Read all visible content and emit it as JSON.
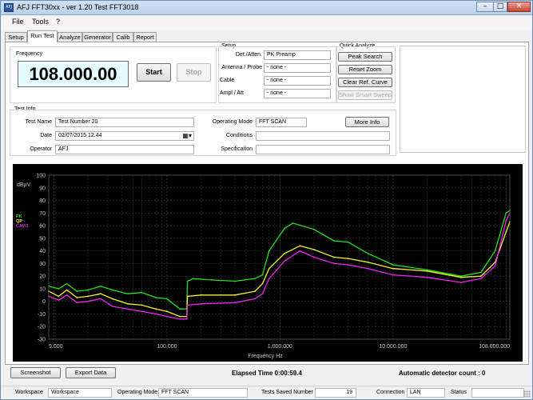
{
  "window": {
    "title": "AFJ FFT30xx - ver 1.20 Test FFT3018",
    "icon": "afj-app-icon",
    "controls": {
      "minimize": "–",
      "maximize": "□",
      "close": "✕"
    }
  },
  "menu": {
    "items": [
      "File",
      "Tools",
      "?"
    ]
  },
  "tabs": [
    "Setup",
    "Run Test",
    "Analyze",
    "Generator",
    "Calib",
    "Report"
  ],
  "active_tab": "Run Test",
  "frequency": {
    "label": "Frequency",
    "value": "108.000.00"
  },
  "controls": {
    "start": "Start",
    "stop": "Stop"
  },
  "setup": {
    "title": "Setup",
    "rows": [
      {
        "label": "Det./Atten.",
        "value": "PK  Preamp"
      },
      {
        "label": "Antenna / Probe",
        "value": "- none -"
      },
      {
        "label": "Cable",
        "value": "- none -"
      },
      {
        "label": "Ampl / Att",
        "value": "- none -"
      }
    ]
  },
  "quick_analyze": {
    "title": "Quick Analyze",
    "buttons": [
      "Peak Search",
      "Reset Zoom",
      "Clear Ref. Curve",
      "Show Smart Sweep"
    ]
  },
  "test_info": {
    "title": "Test Info",
    "test_name_label": "Test Name",
    "test_name": "Test Number 20",
    "date_label": "Date",
    "date": "02/07/2015 12.44",
    "operator_label": "Operator",
    "operator": "AFJ",
    "operating_mode_label": "Operating Mode",
    "operating_mode": "FFT SCAN",
    "conditions_label": "Conditions",
    "conditions": "",
    "specification_label": "Specification",
    "specification": "",
    "more_info": "More Info"
  },
  "chart_data": {
    "type": "line",
    "ylabel": "dBµV",
    "xlabel": "Frequency Hz",
    "x_scale": "log",
    "xlim": [
      9000,
      108000000
    ],
    "ylim": [
      -30,
      100
    ],
    "y_ticks": [
      "100",
      "90",
      "80",
      "70",
      "60",
      "50",
      "40",
      "30",
      "20",
      "10",
      "0",
      "-10",
      "-20",
      "-30"
    ],
    "x_ticks": [
      {
        "value": 9000,
        "label": "9.000"
      },
      {
        "value": 100000,
        "label": "100.000"
      },
      {
        "value": 1000000,
        "label": "1.000.000"
      },
      {
        "value": 10000000,
        "label": "10.000.000"
      },
      {
        "value": 108000000,
        "label": "108.000.000"
      }
    ],
    "grid": true,
    "legend_position": "top-left",
    "series": [
      {
        "name": "PK",
        "color": "#22e11e",
        "points": [
          [
            9000,
            12
          ],
          [
            11000,
            10
          ],
          [
            13000,
            14
          ],
          [
            16000,
            8
          ],
          [
            20000,
            9
          ],
          [
            26000,
            12
          ],
          [
            33000,
            9
          ],
          [
            45000,
            6
          ],
          [
            60000,
            7
          ],
          [
            80000,
            3
          ],
          [
            100000,
            2
          ],
          [
            130000,
            -6
          ],
          [
            150000,
            -6
          ],
          [
            152000,
            16
          ],
          [
            170000,
            18
          ],
          [
            250000,
            17
          ],
          [
            400000,
            16
          ],
          [
            600000,
            18
          ],
          [
            700000,
            21
          ],
          [
            800000,
            40
          ],
          [
            1100000,
            58
          ],
          [
            1300000,
            62
          ],
          [
            2000000,
            57
          ],
          [
            3000000,
            48
          ],
          [
            4000000,
            47
          ],
          [
            6000000,
            38
          ],
          [
            10000000,
            29
          ],
          [
            20000000,
            25
          ],
          [
            40000000,
            20
          ],
          [
            60000000,
            23
          ],
          [
            80000000,
            40
          ],
          [
            100000000,
            70
          ],
          [
            108000000,
            72
          ]
        ]
      },
      {
        "name": "QP",
        "color": "#f3f22b",
        "points": [
          [
            9000,
            8
          ],
          [
            11000,
            4
          ],
          [
            13000,
            9
          ],
          [
            16000,
            3
          ],
          [
            20000,
            4
          ],
          [
            26000,
            6
          ],
          [
            33000,
            2
          ],
          [
            45000,
            -2
          ],
          [
            60000,
            -3
          ],
          [
            80000,
            -6
          ],
          [
            100000,
            -8
          ],
          [
            130000,
            -12
          ],
          [
            150000,
            -12
          ],
          [
            152000,
            4
          ],
          [
            200000,
            5
          ],
          [
            400000,
            5
          ],
          [
            600000,
            8
          ],
          [
            700000,
            14
          ],
          [
            800000,
            26
          ],
          [
            1100000,
            38
          ],
          [
            1500000,
            44
          ],
          [
            2000000,
            41
          ],
          [
            3000000,
            35
          ],
          [
            4000000,
            34
          ],
          [
            6000000,
            31
          ],
          [
            10000000,
            26
          ],
          [
            20000000,
            24
          ],
          [
            40000000,
            19
          ],
          [
            60000000,
            20
          ],
          [
            80000000,
            31
          ],
          [
            100000000,
            55
          ],
          [
            108000000,
            63
          ]
        ]
      },
      {
        "name": "CAVG",
        "color": "#ee22ee",
        "points": [
          [
            9000,
            4
          ],
          [
            11000,
            1
          ],
          [
            13000,
            5
          ],
          [
            16000,
            -1
          ],
          [
            20000,
            0
          ],
          [
            26000,
            2
          ],
          [
            33000,
            -4
          ],
          [
            45000,
            -6
          ],
          [
            60000,
            -8
          ],
          [
            80000,
            -10
          ],
          [
            100000,
            -12
          ],
          [
            130000,
            -14
          ],
          [
            150000,
            -14
          ],
          [
            152000,
            -3
          ],
          [
            200000,
            -2
          ],
          [
            400000,
            -1
          ],
          [
            600000,
            2
          ],
          [
            700000,
            6
          ],
          [
            800000,
            18
          ],
          [
            1100000,
            32
          ],
          [
            1500000,
            40
          ],
          [
            2000000,
            35
          ],
          [
            3000000,
            30
          ],
          [
            4000000,
            29
          ],
          [
            6000000,
            26
          ],
          [
            10000000,
            21
          ],
          [
            20000000,
            19
          ],
          [
            40000000,
            15
          ],
          [
            60000000,
            18
          ],
          [
            80000000,
            28
          ],
          [
            100000000,
            64
          ],
          [
            108000000,
            70
          ]
        ]
      }
    ]
  },
  "bottom": {
    "screenshot": "Screenshot",
    "export": "Export Data",
    "elapsed": "Elapsed Time  0:00:59.4",
    "detector_count": "Automatic detector count : 0"
  },
  "status": {
    "workspace_label": "Workspace",
    "workspace": "Workspace",
    "operating_mode_label": "Operating Mode",
    "operating_mode": "FFT SCAN",
    "tests_saved_label": "Tests Saved Number",
    "tests_saved": "19",
    "connection_label": "Connection",
    "connection": "LAN",
    "status_label": "Status",
    "status": ""
  }
}
